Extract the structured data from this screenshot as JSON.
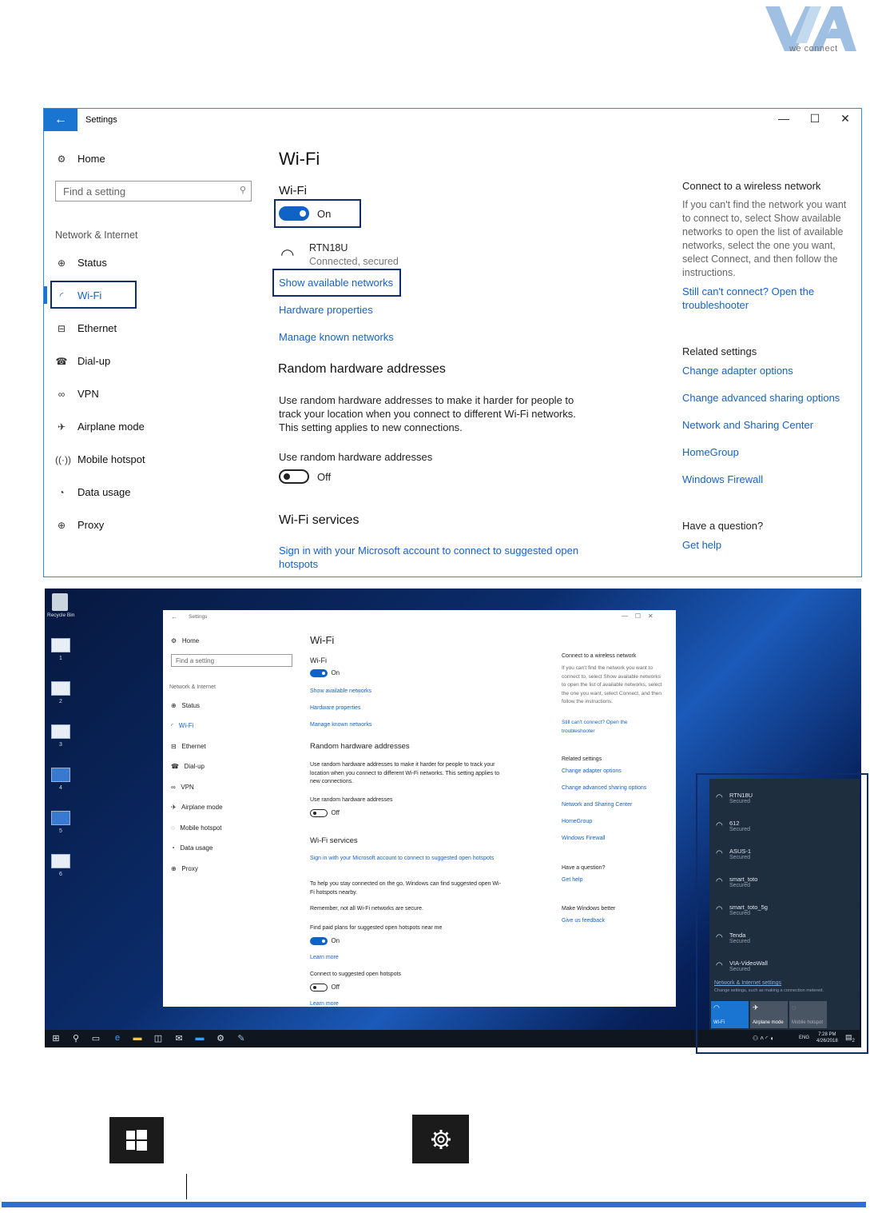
{
  "logo": {
    "tagline": "we connect"
  },
  "window": {
    "title": "Settings",
    "back_glyph": "←",
    "min_glyph": "—",
    "max_glyph": "☐",
    "close_glyph": "✕",
    "home": "Home",
    "search_placeholder": "Find a setting",
    "section": "Network & Internet",
    "nav": [
      "Status",
      "Wi-Fi",
      "Ethernet",
      "Dial-up",
      "VPN",
      "Airplane mode",
      "Mobile hotspot",
      "Data usage",
      "Proxy"
    ],
    "page_title": "Wi-Fi",
    "wifi_label": "Wi-Fi",
    "wifi_state": "On",
    "network_name": "RTN18U",
    "network_status": "Connected, secured",
    "link_show": "Show available networks",
    "link_hardware": "Hardware properties",
    "link_manage": "Manage known networks",
    "random_title": "Random hardware addresses",
    "random_desc": "Use random hardware addresses to make it harder for people to track your location when you connect to different Wi-Fi networks. This setting applies to new connections.",
    "random_label": "Use random hardware addresses",
    "random_state": "Off",
    "services_title": "Wi-Fi services",
    "services_link": "Sign in with your Microsoft account to connect to suggested open hotspots",
    "right": {
      "connect_title": "Connect to a wireless network",
      "connect_desc": "If you can't find the network you want to connect to, select Show available networks to open the list of available networks, select the one you want, select Connect, and then follow the instructions.",
      "troubleshoot": "Still can't connect? Open the troubleshooter",
      "related_title": "Related settings",
      "related": [
        "Change adapter options",
        "Change advanced sharing options",
        "Network and Sharing Center",
        "HomeGroup",
        "Windows Firewall"
      ],
      "question_title": "Have a question?",
      "get_help": "Get help"
    }
  },
  "desktop": {
    "recycle_label": "Recycle Bin",
    "icons": [
      "1",
      "2",
      "3",
      "4",
      "5",
      "6"
    ],
    "mini": {
      "title": "Settings",
      "home": "Home",
      "search": "Find a setting",
      "section": "Network & Internet",
      "nav": [
        "Status",
        "Wi-Fi",
        "Ethernet",
        "Dial-up",
        "VPN",
        "Airplane mode",
        "Mobile hotspot",
        "Data usage",
        "Proxy"
      ],
      "page_title": "Wi-Fi",
      "wifi_label": "Wi-Fi",
      "wifi_state": "On",
      "links": [
        "Show available networks",
        "Hardware properties",
        "Manage known networks"
      ],
      "random_title": "Random hardware addresses",
      "random_desc": "Use random hardware addresses to make it harder for people to track your location when you connect to different Wi-Fi networks. This setting applies to new connections.",
      "random_label": "Use random hardware addresses",
      "random_state": "Off",
      "services_title": "Wi-Fi services",
      "services_link": "Sign in with your Microsoft account to connect to suggested open hotspots",
      "stay_connected": "To help you stay connected on the go, Windows can find suggested open Wi-Fi hotspots nearby.",
      "remember": "Remember, not all Wi-Fi networks are secure.",
      "paid_label": "Find paid plans for suggested open hotspots near me",
      "paid_state": "On",
      "learn_more": "Learn more",
      "connect_label": "Connect to suggested open hotspots",
      "connect_state": "Off",
      "learn_more2": "Learn more",
      "right_connect_title": "Connect to a wireless network",
      "right_connect_desc": "If you can't find the network you want to connect to, select Show available networks to open the list of available networks, select the one you want, select Connect, and then follow the instructions.",
      "right_troubleshoot": "Still can't connect? Open the troubleshooter",
      "related_title": "Related settings",
      "related": [
        "Change adapter options",
        "Change advanced sharing options",
        "Network and Sharing Center",
        "HomeGroup",
        "Windows Firewall"
      ],
      "question_title": "Have a question?",
      "get_help": "Get help",
      "better_title": "Make Windows better",
      "feedback": "Give us feedback"
    },
    "flyout": {
      "networks": [
        {
          "name": "RTN18U",
          "status": "Secured"
        },
        {
          "name": "612",
          "status": "Secured"
        },
        {
          "name": "ASUS-1",
          "status": "Secured"
        },
        {
          "name": "smart_toto",
          "status": "Secured"
        },
        {
          "name": "smart_toto_5g",
          "status": "Secured"
        },
        {
          "name": "Tenda",
          "status": "Secured"
        },
        {
          "name": "VIA-VideoWall",
          "status": "Secured"
        }
      ],
      "settings_link": "Network & Internet settings",
      "settings_desc": "Change settings, such as making a connection metered.",
      "tiles": [
        "Wi-Fi",
        "Airplane mode",
        "Mobile hotspot"
      ]
    },
    "taskbar": {
      "lang": "ENG",
      "time": "7:28 PM",
      "date": "4/26/2018",
      "notif": "2"
    }
  }
}
